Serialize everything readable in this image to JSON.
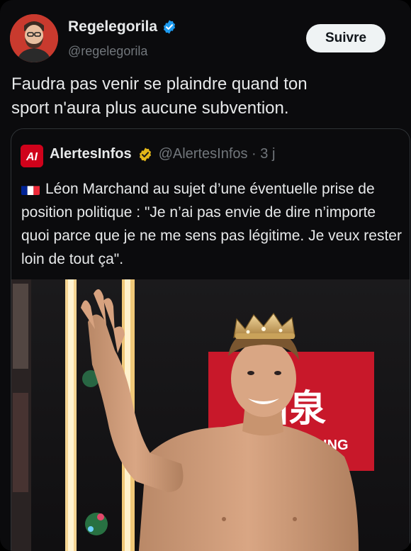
{
  "post": {
    "author_name": "Regelegorila",
    "author_handle": "@regelegorila",
    "follow_label": "Suivre",
    "text": "Faudra pas venir se plaindre quand ton\nsport n'aura plus aucune subvention."
  },
  "quoted": {
    "logo_text": "AI",
    "author_name": "AlertesInfos",
    "meta": "@AlertesInfos · 3 j",
    "text": "Léon Marchand au sujet d’une éventuelle prise de position politique : \"Je n’ai pas envie de dire n’importe quoi parce que je ne me sens pas légitime. Je veux rester loin de tout ça\".",
    "banner_text": "山泉",
    "banner_subtext": "ING"
  },
  "colors": {
    "background": "#0b0b0d",
    "text": "#e7e9ea",
    "muted": "#71767b",
    "verified_blue": "#1d9bf0",
    "verified_gold": "#e2b719",
    "accent_red": "#d0021b"
  },
  "icons": {
    "verified": "verified-badge-icon",
    "gold_verified": "gold-verified-badge-icon",
    "flag": "france-flag-icon"
  }
}
